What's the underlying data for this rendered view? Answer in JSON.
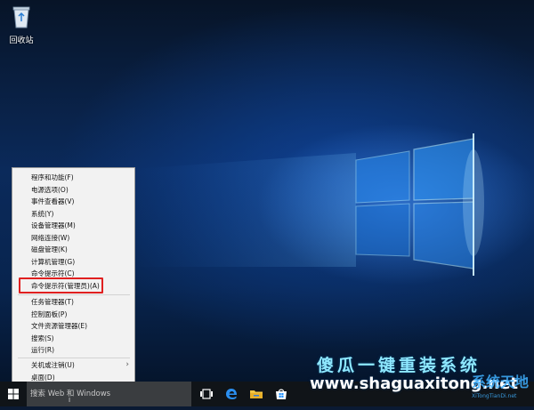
{
  "desktop": {
    "recycle_bin_label": "回收站"
  },
  "winx_menu": {
    "group1": [
      "程序和功能(F)",
      "电源选项(O)",
      "事件查看器(V)",
      "系统(Y)",
      "设备管理器(M)",
      "网络连接(W)",
      "磁盘管理(K)",
      "计算机管理(G)",
      "命令提示符(C)",
      "命令提示符(管理员)(A)"
    ],
    "group2": [
      "任务管理器(T)",
      "控制面板(P)",
      "文件资源管理器(E)",
      "搜索(S)",
      "运行(R)"
    ],
    "group3": [
      "关机或注销(U)",
      "桌面(D)"
    ],
    "highlighted_item": "命令提示符(管理员)(A)",
    "submenu_arrow": "›"
  },
  "taskbar": {
    "search_placeholder": "搜索 Web 和 Windows",
    "icons": [
      "windows-start-icon",
      "task-view-icon",
      "edge-icon",
      "file-explorer-icon",
      "store-icon"
    ]
  },
  "watermark": {
    "title": "傻瓜一键重装系统",
    "url": "www.shaguaxitong.net",
    "logo_text": "系统天地",
    "logo_sub": "XiTongTianDi.net"
  },
  "colors": {
    "highlight_border": "#e02020",
    "menu_bg": "#f2f2f2",
    "taskbar_bg": "#101418",
    "accent": "#1e90ff"
  }
}
